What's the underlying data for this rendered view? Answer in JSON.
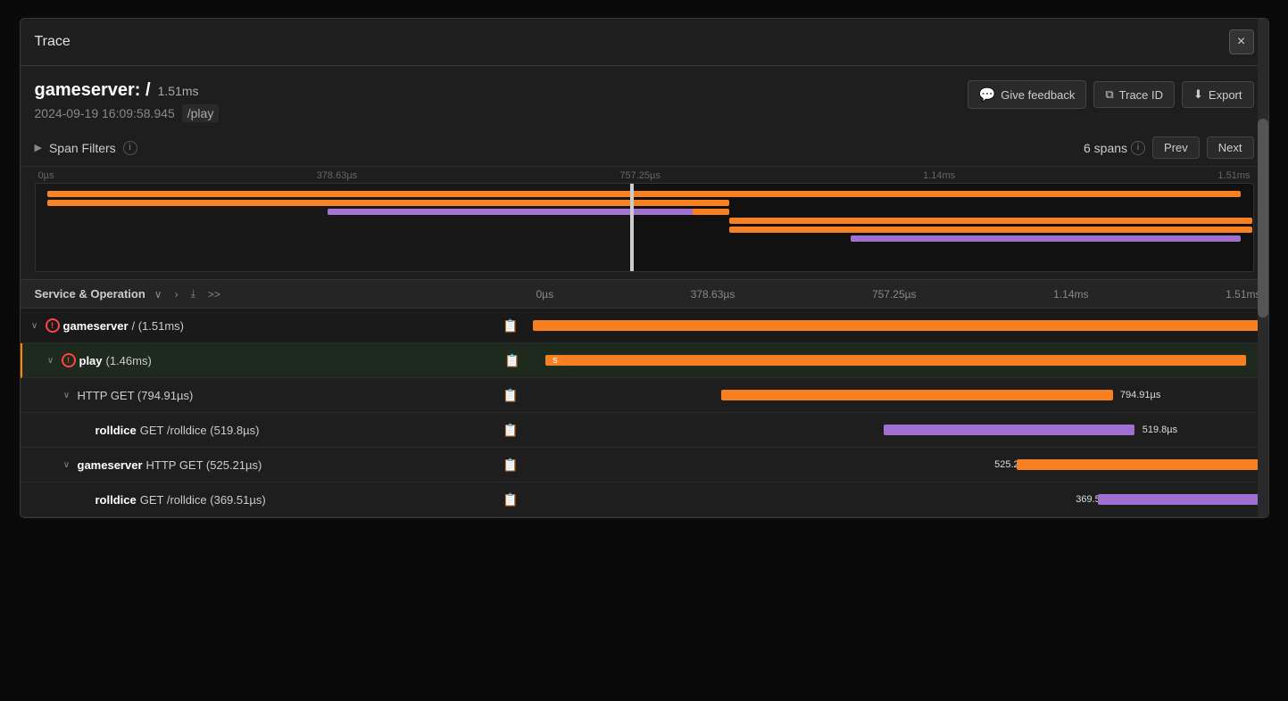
{
  "modal": {
    "title": "Trace",
    "close_label": "×"
  },
  "trace": {
    "service": "gameserver: /",
    "duration": "1.51ms",
    "date": "2024-09-19 16:09:58.945",
    "path": "/play",
    "give_feedback_label": "Give feedback",
    "trace_id_label": "Trace ID",
    "export_label": "Export"
  },
  "filters": {
    "label": "Span Filters",
    "spans_count": "6 spans",
    "prev_label": "Prev",
    "next_label": "Next"
  },
  "minimap": {
    "labels": [
      "0µs",
      "378.63µs",
      "757.25µs",
      "1.14ms",
      "1.51ms"
    ]
  },
  "header": {
    "service_op_label": "Service & Operation",
    "timeline_labels": [
      "0µs",
      "378.63µs",
      "757.25µs",
      "1.14ms",
      "1.51ms"
    ]
  },
  "spans": [
    {
      "id": "row1",
      "level": 0,
      "expandable": true,
      "expanded": true,
      "has_error": true,
      "service": "gameserver",
      "op": " / (1.51ms)",
      "duration": "",
      "has_log": true,
      "bar_type": "orange",
      "bar_left_pct": 0.5,
      "bar_width_pct": 98,
      "bar_label": "",
      "bar_label_left_pct": null
    },
    {
      "id": "row2",
      "level": 1,
      "expandable": true,
      "expanded": true,
      "has_error": true,
      "service": "play",
      "op": " (1.46ms)",
      "duration": "",
      "has_log": true,
      "bar_type": "orange",
      "bar_left_pct": 2,
      "bar_width_pct": 96,
      "bar_label": "s",
      "bar_label_left_pct": 1
    },
    {
      "id": "row3",
      "level": 2,
      "expandable": true,
      "expanded": true,
      "has_error": false,
      "service": "",
      "op": "HTTP GET (794.91µs)",
      "duration": "",
      "has_log": true,
      "bar_type": "orange",
      "bar_left_pct": 27,
      "bar_width_pct": 52,
      "bar_label": "794.91µs",
      "bar_label_left_pct": 80
    },
    {
      "id": "row4",
      "level": 3,
      "expandable": false,
      "expanded": false,
      "has_error": false,
      "service": "rolldice",
      "op": "  GET /rolldice (519.8µs)",
      "duration": "",
      "has_log": true,
      "bar_type": "purple",
      "bar_left_pct": 48,
      "bar_width_pct": 34,
      "bar_label": "519.8µs",
      "bar_label_left_pct": 83
    },
    {
      "id": "row5",
      "level": 2,
      "expandable": true,
      "expanded": true,
      "has_error": false,
      "service": "gameserver",
      "op": "  HTTP GET (525.21µs)",
      "duration": "",
      "has_log": true,
      "bar_type": "orange",
      "bar_left_pct": 64,
      "bar_width_pct": 35,
      "bar_label": "525.21µs",
      "bar_label_left_pct": 63
    },
    {
      "id": "row6",
      "level": 3,
      "expandable": false,
      "expanded": false,
      "has_error": false,
      "service": "rolldice",
      "op": "  GET /rolldice (369.51µs)",
      "duration": "",
      "has_log": true,
      "bar_type": "purple",
      "bar_left_pct": 76,
      "bar_width_pct": 23,
      "bar_label": "369.51µs",
      "bar_label_left_pct": 75
    }
  ],
  "colors": {
    "orange": "#f88020",
    "purple": "#a070d0",
    "bg": "#1e1e1e",
    "border": "#3a3a3a"
  }
}
